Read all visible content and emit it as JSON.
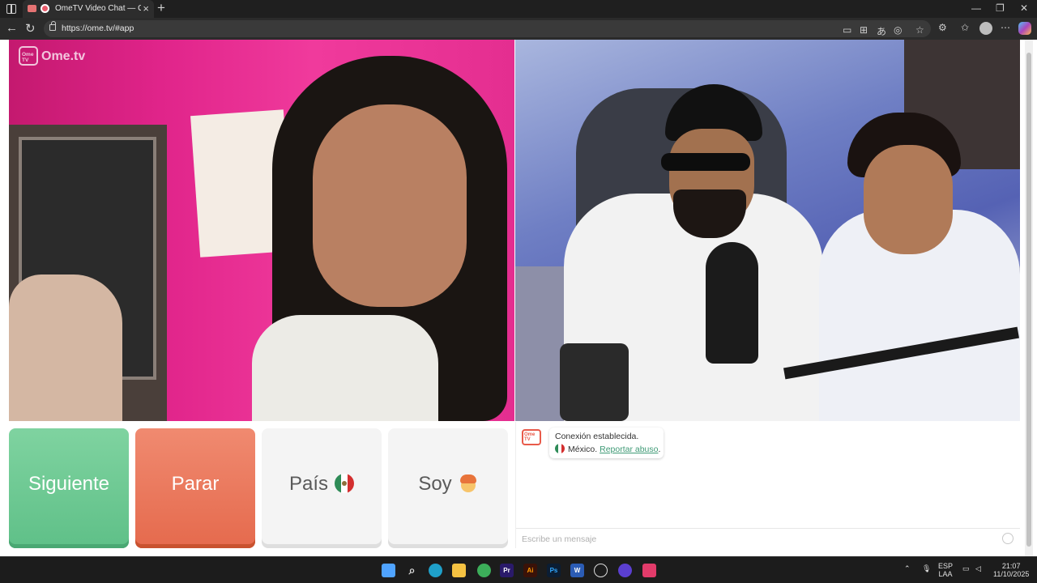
{
  "browser": {
    "tab_title": "OmeTV Video Chat — Ome",
    "url": "https://ome.tv/#app"
  },
  "logo": {
    "badge": "Ome TV",
    "wordmark": "Ome.tv"
  },
  "buttons": {
    "next": "Siguiente",
    "stop": "Parar",
    "country": "País",
    "i_am": "Soy"
  },
  "chat": {
    "avatar_text": "Ome TV",
    "status": "Conexión establecida.",
    "country": "México.",
    "report_link": "Reportar abuso",
    "report_suffix": ".",
    "input_placeholder": "Escribe un mensaje"
  },
  "taskbar": {
    "lang_top": "ESP",
    "lang_bottom": "LAA",
    "time": "21:07",
    "date": "11/10/2025"
  },
  "colors": {
    "next_button": "#6cc994",
    "stop_button": "#eb7558",
    "link": "#3f9a76"
  },
  "icons": [
    "back-icon",
    "refresh-icon",
    "lock-icon",
    "star-icon",
    "extensions-icon",
    "favorites-icon",
    "profile-icon",
    "menu-icon",
    "copilot-icon",
    "mexico-flag-icon",
    "boy-emoji-icon",
    "smiley-icon"
  ]
}
